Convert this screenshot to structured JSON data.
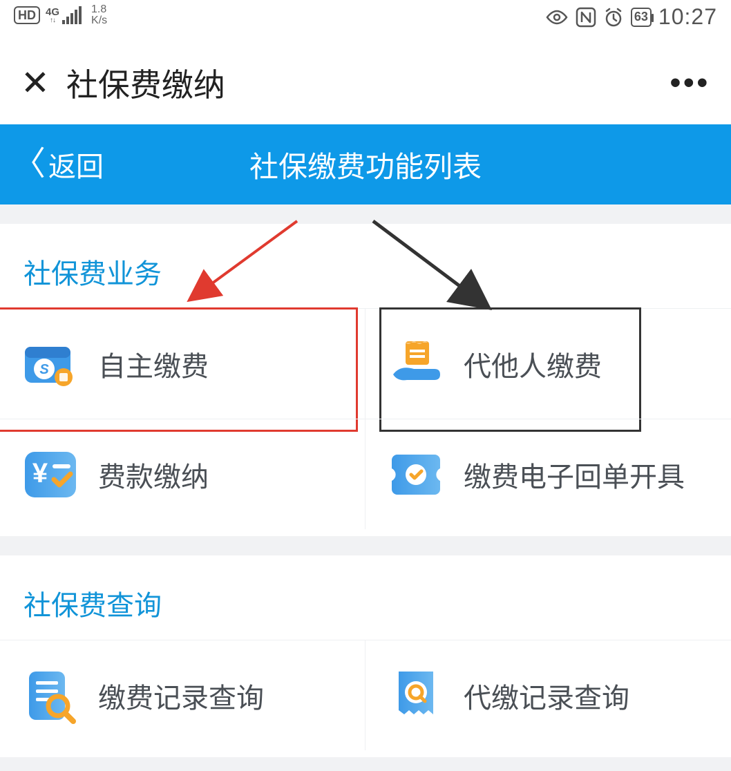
{
  "status": {
    "hd": "HD",
    "net_gen": "4G",
    "speed_val": "1.8",
    "speed_unit": "K/s",
    "battery": "63",
    "time": "10:27"
  },
  "window": {
    "title": "社保费缴纳"
  },
  "nav": {
    "back_label": "返回",
    "title": "社保缴费功能列表"
  },
  "sections": [
    {
      "title": "社保费业务",
      "items": [
        {
          "label": "自主缴费",
          "icon": "wallet-s-icon",
          "highlight": "red"
        },
        {
          "label": "代他人缴费",
          "icon": "hand-ticket-icon",
          "highlight": "dark"
        },
        {
          "label": "费款缴纳",
          "icon": "yen-check-icon"
        },
        {
          "label": "缴费电子回单开具",
          "icon": "ticket-check-icon"
        }
      ]
    },
    {
      "title": "社保费查询",
      "items": [
        {
          "label": "缴费记录查询",
          "icon": "doc-search-icon"
        },
        {
          "label": "代缴记录查询",
          "icon": "receipt-search-icon"
        }
      ]
    }
  ],
  "colors": {
    "primary": "#0e99e8",
    "highlight_red": "#e03a2f",
    "highlight_dark": "#333333"
  }
}
